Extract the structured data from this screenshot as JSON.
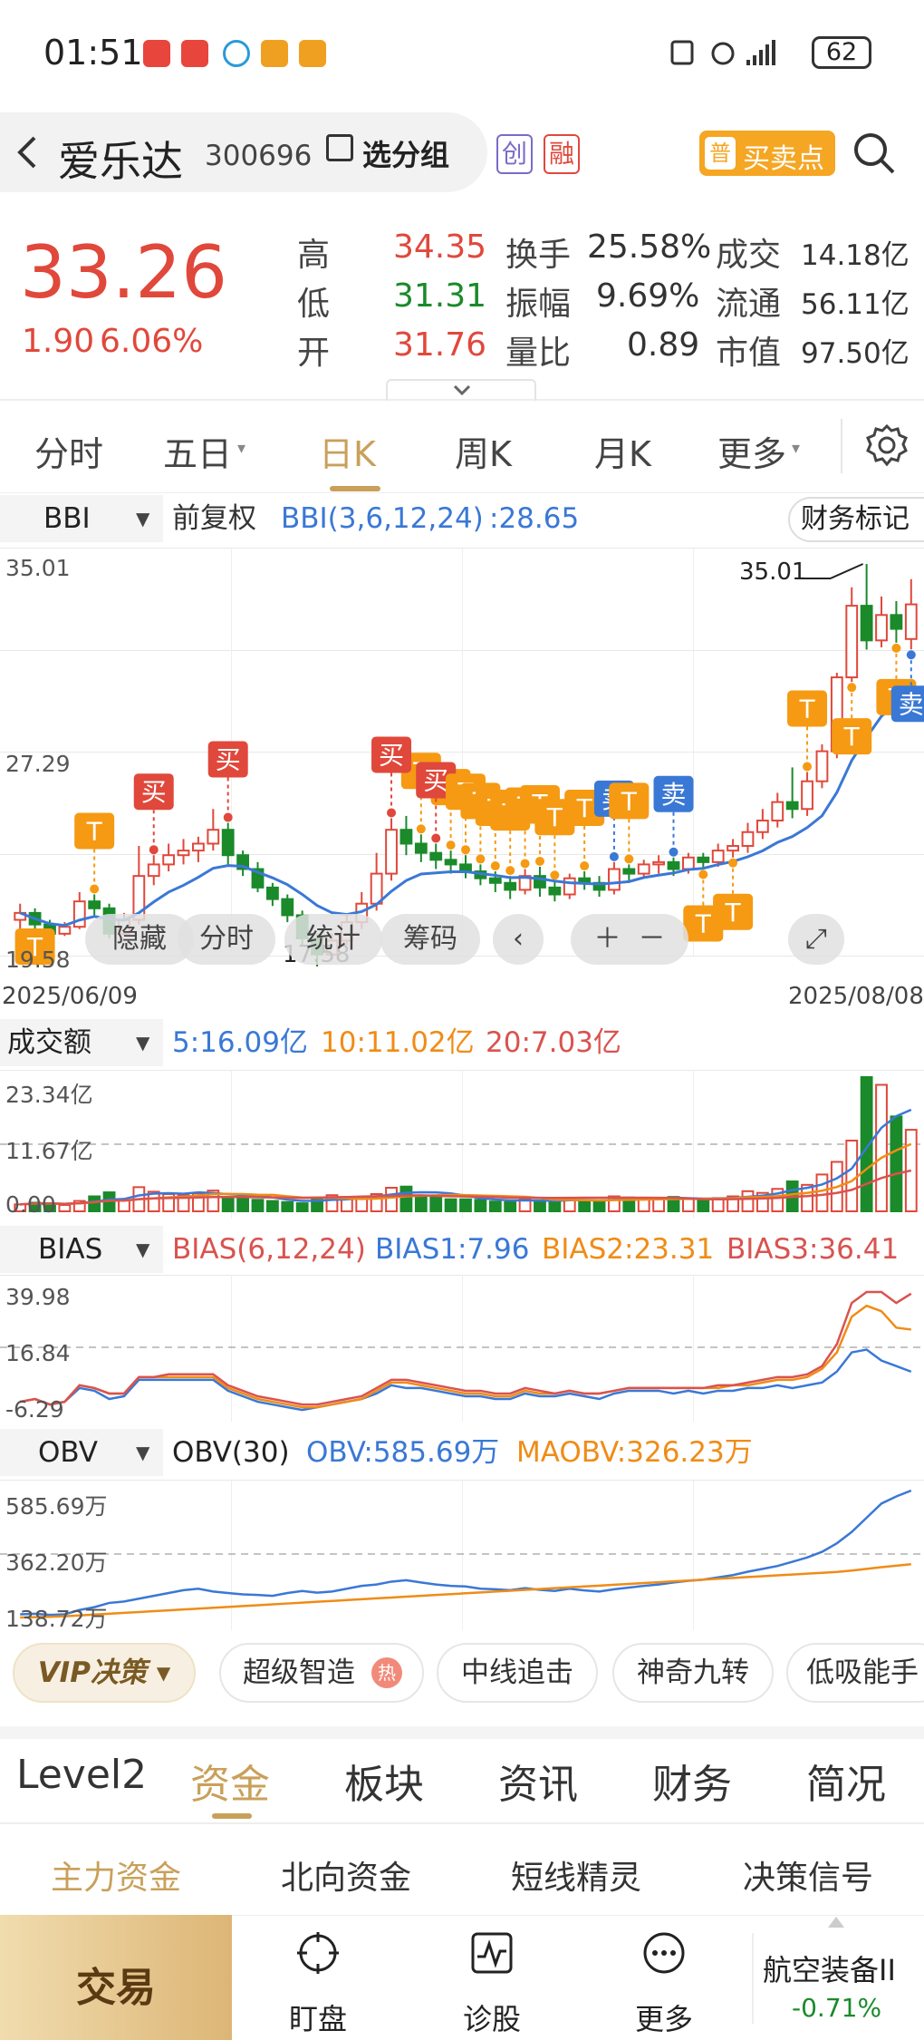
{
  "status_bar": {
    "time": "01:51",
    "battery": "62"
  },
  "header": {
    "stock_name": "爱乐达",
    "stock_code": "300696",
    "group_button": "选分组",
    "badge_chuang": "创",
    "badge_rong": "融",
    "buy_sell_badge": "普",
    "buy_sell_label": "买卖点"
  },
  "quote": {
    "price": "33.26",
    "change": "1.90",
    "change_pct": "6.06%",
    "high_label": "高",
    "high": "34.35",
    "low_label": "低",
    "low": "31.31",
    "open_label": "开",
    "open": "31.76",
    "turnover_label": "换手",
    "turnover": "25.58%",
    "amplitude_label": "振幅",
    "amplitude": "9.69%",
    "vol_ratio_label": "量比",
    "vol_ratio": "0.89",
    "amount_label": "成交",
    "amount": "14.18亿",
    "float_label": "流通",
    "float_cap": "56.11亿",
    "mktcap_label": "市值",
    "mktcap": "97.50亿"
  },
  "period_tabs": [
    "分时",
    "五日",
    "日K",
    "周K",
    "月K",
    "更多"
  ],
  "active_period": "日K",
  "kline": {
    "indicator_select": "BBI",
    "adjust": "前复权",
    "indicator_text": "BBI(3,6,12,24)",
    "indicator_value": ":28.65",
    "finance_mark": "财务标记",
    "y_top": "35.01",
    "y_mid": "27.29",
    "y_low": "19.58",
    "max_label": "35.01",
    "min_label": "17.58",
    "date_start": "2025/06/09",
    "date_end": "2025/08/08",
    "overlay_buttons": [
      "隐藏",
      "分时",
      "统计",
      "筹码"
    ],
    "signal_buy": "买",
    "signal_sell": "卖",
    "signal_t": "T"
  },
  "volume": {
    "select": "成交额",
    "ma5": "5:16.09亿",
    "ma10": "10:11.02亿",
    "ma20": "20:7.03亿",
    "y_top": "23.34亿",
    "y_mid": "11.67亿",
    "y_low": "0.00"
  },
  "bias": {
    "select": "BIAS",
    "params": "BIAS(6,12,24)",
    "b1": "BIAS1:7.96",
    "b2": "BIAS2:23.31",
    "b3": "BIAS3:36.41",
    "y_top": "39.98",
    "y_mid": "16.84",
    "y_low": "-6.29"
  },
  "obv": {
    "select": "OBV",
    "params": "OBV(30)",
    "obv": "OBV:585.69万",
    "maobv": "MAOBV:326.23万",
    "y_top": "585.69万",
    "y_mid": "362.20万",
    "y_low": "138.72万"
  },
  "strategies": {
    "vip": "VIP决策",
    "items": [
      "超级智造",
      "中线追击",
      "神奇九转",
      "低吸能手"
    ],
    "hot": "热"
  },
  "info_tabs": [
    "Level2",
    "资金",
    "板块",
    "资讯",
    "财务",
    "简况"
  ],
  "active_info_tab": "资金",
  "sub_tabs": [
    "主力资金",
    "北向资金",
    "短线精灵",
    "决策信号"
  ],
  "bottom_bar": {
    "trade": "交易",
    "watch": "盯盘",
    "diagnose": "诊股",
    "more": "更多",
    "sector_name": "航空装备II",
    "sector_change": "-0.71%"
  },
  "colors": {
    "up": "#e0483b",
    "down": "#1a8a2a",
    "bbi": "#3a78d6",
    "accent_gold": "#c9a05a",
    "signal_orange": "#f59a12"
  },
  "chart_data": [
    {
      "type": "candlestick",
      "title": "日K",
      "x_range": [
        "2025/06/09",
        "2025/08/08"
      ],
      "ylim": [
        17.58,
        35.01
      ],
      "y_ticks": [
        35.01,
        27.29,
        19.58
      ],
      "candles": [
        [
          19.6,
          19.9,
          19.2,
          20.3
        ],
        [
          19.9,
          19.4,
          19.1,
          20.1
        ],
        [
          19.4,
          19.0,
          18.8,
          19.6
        ],
        [
          19.0,
          19.3,
          18.9,
          19.5
        ],
        [
          19.3,
          20.4,
          19.2,
          20.8
        ],
        [
          20.4,
          20.1,
          19.8,
          20.7
        ],
        [
          20.1,
          19.0,
          18.8,
          20.3
        ],
        [
          19.0,
          19.6,
          18.9,
          19.9
        ],
        [
          19.6,
          21.5,
          19.4,
          22.8
        ],
        [
          21.5,
          22.0,
          21.1,
          22.4
        ],
        [
          22.0,
          22.4,
          21.7,
          22.9
        ],
        [
          22.4,
          22.6,
          22.0,
          23.1
        ],
        [
          22.6,
          22.9,
          22.1,
          23.2
        ],
        [
          22.9,
          23.5,
          22.6,
          24.4
        ],
        [
          23.5,
          22.4,
          22.0,
          23.8
        ],
        [
          22.4,
          21.8,
          21.5,
          22.6
        ],
        [
          21.8,
          21.0,
          20.8,
          22.1
        ],
        [
          21.0,
          20.5,
          20.2,
          21.2
        ],
        [
          20.5,
          19.8,
          19.5,
          20.7
        ],
        [
          19.8,
          18.8,
          18.5,
          20.0
        ],
        [
          18.8,
          18.1,
          17.58,
          19.0
        ],
        [
          18.1,
          18.7,
          17.9,
          19.0
        ],
        [
          18.7,
          19.5,
          18.5,
          19.8
        ],
        [
          19.5,
          20.3,
          19.2,
          20.8
        ],
        [
          20.3,
          21.6,
          20.0,
          22.5
        ],
        [
          21.6,
          23.5,
          21.3,
          24.0
        ],
        [
          23.5,
          22.9,
          22.4,
          24.1
        ],
        [
          22.9,
          22.5,
          22.1,
          23.3
        ],
        [
          22.5,
          22.2,
          21.8,
          22.9
        ],
        [
          22.2,
          22.0,
          21.6,
          22.6
        ],
        [
          22.0,
          21.7,
          21.4,
          22.4
        ],
        [
          21.7,
          21.4,
          21.1,
          22.0
        ],
        [
          21.4,
          21.2,
          20.8,
          21.7
        ],
        [
          21.2,
          20.9,
          20.5,
          21.5
        ],
        [
          20.9,
          21.5,
          20.7,
          21.8
        ],
        [
          21.5,
          21.0,
          20.6,
          21.9
        ],
        [
          21.0,
          20.7,
          20.4,
          21.3
        ],
        [
          20.7,
          21.4,
          20.5,
          21.6
        ],
        [
          21.4,
          21.2,
          20.9,
          21.7
        ],
        [
          21.2,
          20.9,
          20.6,
          21.5
        ],
        [
          20.9,
          21.8,
          20.7,
          22.1
        ],
        [
          21.8,
          21.6,
          21.2,
          22.0
        ],
        [
          21.6,
          22.0,
          21.4,
          22.2
        ],
        [
          22.0,
          22.1,
          21.6,
          22.4
        ],
        [
          22.1,
          21.8,
          21.5,
          22.3
        ],
        [
          21.8,
          22.3,
          21.6,
          22.5
        ],
        [
          22.3,
          22.1,
          21.8,
          22.5
        ],
        [
          22.1,
          22.6,
          21.9,
          22.9
        ],
        [
          22.6,
          22.8,
          22.3,
          23.1
        ],
        [
          22.8,
          23.4,
          22.5,
          23.8
        ],
        [
          23.4,
          23.9,
          23.1,
          24.4
        ],
        [
          23.9,
          24.7,
          23.6,
          25.1
        ],
        [
          24.7,
          24.4,
          24.0,
          26.2
        ],
        [
          24.4,
          25.6,
          24.1,
          26.0
        ],
        [
          25.6,
          26.9,
          25.3,
          27.2
        ],
        [
          26.9,
          30.1,
          26.6,
          30.3
        ],
        [
          30.1,
          33.2,
          29.9,
          34.0
        ],
        [
          33.2,
          31.7,
          31.3,
          35.01
        ],
        [
          31.7,
          32.8,
          31.4,
          33.6
        ],
        [
          32.8,
          32.2,
          31.6,
          33.4
        ],
        [
          31.76,
          33.26,
          31.31,
          34.35
        ]
      ],
      "bbi_value": 28.65
    },
    {
      "type": "bar",
      "title": "成交额",
      "ylim": [
        0,
        23.34
      ],
      "unit": "亿",
      "values": [
        1.2,
        1.5,
        1.4,
        1.1,
        1.8,
        2.6,
        3.3,
        1.9,
        4.2,
        3.4,
        3.0,
        2.8,
        3.1,
        3.6,
        2.4,
        2.3,
        2.0,
        1.8,
        1.6,
        1.4,
        2.4,
        2.8,
        2.2,
        2.5,
        3.0,
        4.1,
        4.3,
        2.7,
        2.4,
        2.1,
        2.1,
        2.0,
        1.7,
        1.6,
        2.2,
        1.9,
        1.7,
        2.3,
        1.8,
        1.7,
        2.6,
        2.4,
        2.2,
        2.1,
        2.5,
        2.2,
        2.0,
        2.3,
        2.6,
        3.5,
        3.2,
        3.9,
        5.2,
        4.6,
        6.4,
        8.6,
        12.3,
        23.34,
        22.0,
        16.5,
        14.18
      ],
      "ma5": 16.09,
      "ma10": 11.02,
      "ma20": 7.03
    },
    {
      "type": "line",
      "title": "BIAS(6,12,24)",
      "ylim": [
        -6.29,
        39.98
      ],
      "series": [
        {
          "name": "BIAS1",
          "values": [
            -3,
            -2,
            -4,
            -3,
            2,
            1,
            -2,
            -1,
            5,
            5,
            5,
            5,
            5,
            5,
            1,
            -1,
            -3,
            -4,
            -5,
            -6,
            -5,
            -4,
            -3,
            -2,
            0,
            3,
            2,
            2,
            1,
            0,
            -1,
            -1,
            -2,
            -2,
            0,
            -1,
            -1,
            0,
            -1,
            -2,
            0,
            1,
            1,
            1,
            0,
            1,
            0,
            1,
            1,
            2,
            2,
            3,
            2,
            3,
            4,
            8,
            15,
            16,
            12,
            10,
            7.96
          ]
        },
        {
          "name": "BIAS2",
          "values": [
            -3,
            -2,
            -4,
            -3,
            3,
            2,
            0,
            0,
            6,
            6,
            6,
            6,
            6,
            6,
            2,
            0,
            -2,
            -3,
            -4,
            -5,
            -5,
            -4,
            -3,
            -2,
            1,
            4,
            4,
            3,
            2,
            1,
            0,
            0,
            -1,
            -1,
            1,
            0,
            0,
            1,
            0,
            0,
            1,
            2,
            2,
            2,
            2,
            2,
            2,
            2,
            3,
            3,
            4,
            5,
            5,
            6,
            9,
            15,
            28,
            32,
            30,
            24,
            23.31
          ]
        },
        {
          "name": "BIAS3",
          "values": [
            -3,
            -2,
            -4,
            -3,
            3,
            2,
            0,
            0,
            6,
            6,
            7,
            7,
            7,
            7,
            3,
            1,
            -1,
            -2,
            -3,
            -4,
            -4,
            -3,
            -2,
            -1,
            2,
            5,
            5,
            4,
            3,
            2,
            1,
            1,
            0,
            0,
            2,
            1,
            0,
            1,
            0,
            0,
            1,
            2,
            2,
            2,
            2,
            2,
            2,
            3,
            3,
            4,
            5,
            6,
            6,
            7,
            10,
            18,
            33,
            37,
            37,
            33,
            36.41
          ]
        }
      ]
    },
    {
      "type": "line",
      "title": "OBV(30)",
      "ylim": [
        138.72,
        585.69
      ],
      "unit": "万",
      "series": [
        {
          "name": "OBV",
          "values": [
            150,
            152,
            148,
            150,
            165,
            175,
            190,
            195,
            205,
            215,
            225,
            235,
            240,
            230,
            225,
            220,
            218,
            215,
            225,
            232,
            226,
            230,
            240,
            250,
            255,
            265,
            270,
            262,
            255,
            250,
            248,
            240,
            238,
            235,
            242,
            236,
            232,
            240,
            234,
            230,
            238,
            244,
            250,
            255,
            262,
            268,
            272,
            280,
            288,
            300,
            310,
            320,
            335,
            350,
            370,
            400,
            440,
            490,
            540,
            565,
            585.69
          ]
        },
        {
          "name": "MAOBV",
          "values": [
            138.72,
            140,
            141,
            143,
            146,
            149,
            152,
            155,
            158,
            161,
            164,
            167,
            170,
            173,
            176,
            179,
            182,
            185,
            188,
            191,
            194,
            197,
            200,
            203,
            206,
            209,
            212,
            215,
            218,
            221,
            224,
            227,
            230,
            233,
            236,
            239,
            242,
            245,
            248,
            251,
            254,
            257,
            260,
            263,
            266,
            269,
            272,
            275,
            278,
            281,
            284,
            287,
            290,
            293,
            296,
            299,
            304,
            310,
            316,
            321,
            326.23
          ]
        }
      ]
    }
  ]
}
